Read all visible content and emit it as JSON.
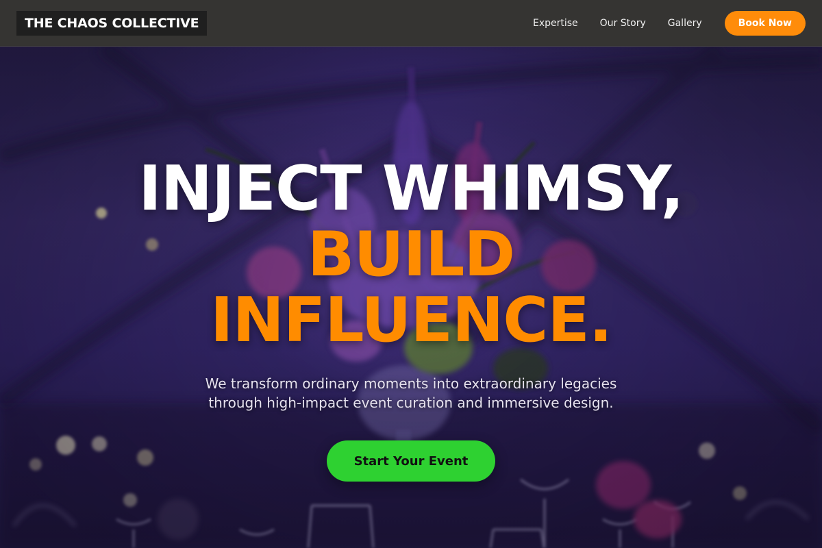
{
  "nav": {
    "logo": "THE CHAOS COLLECTIVE",
    "links": [
      "Expertise",
      "Our Story",
      "Gallery"
    ],
    "cta": "Book Now"
  },
  "hero": {
    "headline_line1": "INJECT WHIMSY,",
    "headline_line2": "BUILD",
    "headline_line3": "INFLUENCE.",
    "subtext_line1": "We transform ordinary moments into extraordinary legacies",
    "subtext_line2": "through high-impact event curation and immersive design.",
    "cta": "Start Your Event"
  },
  "colors": {
    "nav_bg": "#353432",
    "accent_orange": "#ff8c00",
    "cta_green": "#2ed131",
    "hero_purple": "#3a2d6b"
  }
}
